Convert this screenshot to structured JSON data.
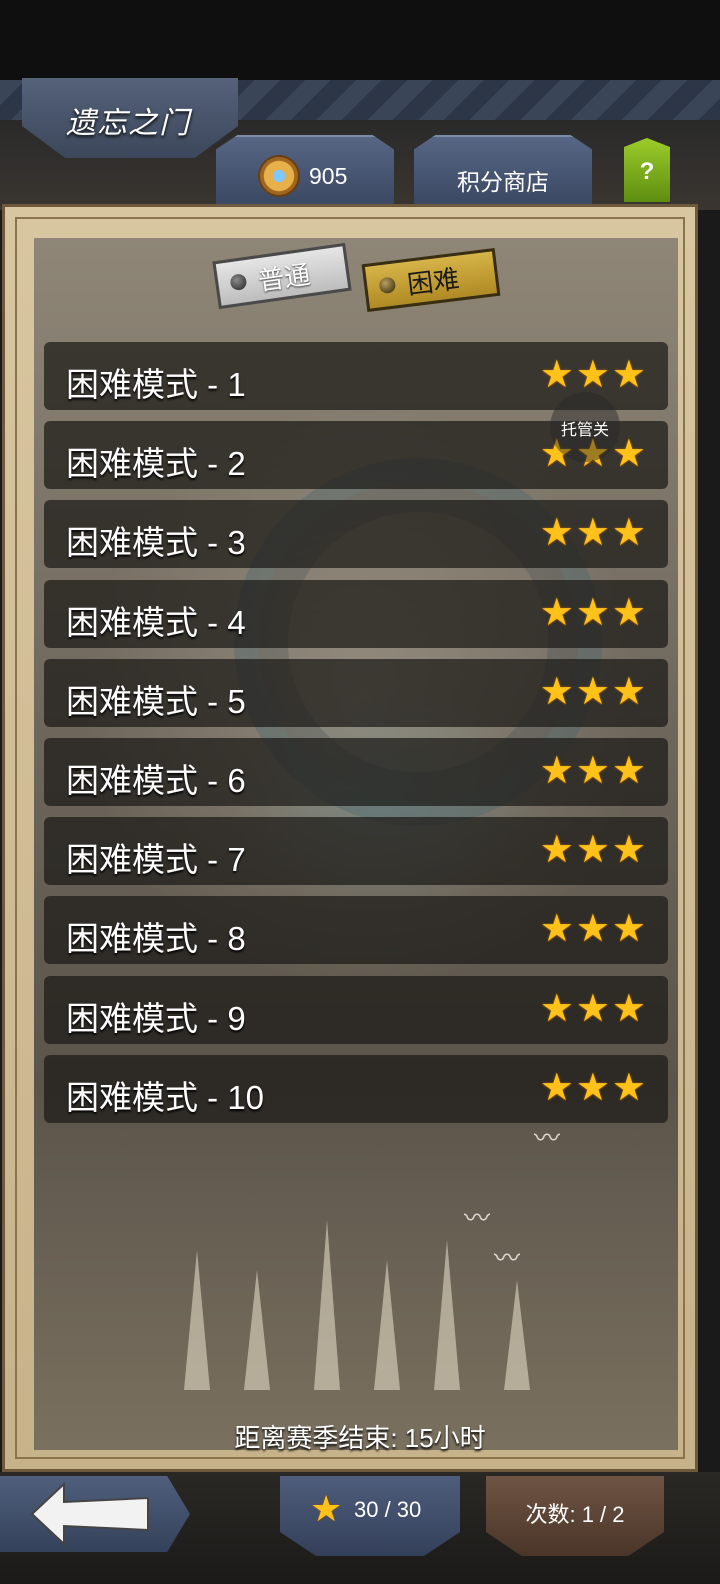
{
  "header": {
    "title": "遗忘之门",
    "coins": "905",
    "shop_label": "积分商店",
    "help_label": "?"
  },
  "mode_tabs": {
    "normal_label": "普通",
    "hard_label": "困难",
    "selected": "hard"
  },
  "levels": [
    {
      "label": "困难模式 - 1",
      "stars": 3
    },
    {
      "label": "困难模式 - 2",
      "stars": 3
    },
    {
      "label": "困难模式 - 3",
      "stars": 3
    },
    {
      "label": "困难模式 - 4",
      "stars": 3
    },
    {
      "label": "困难模式 - 5",
      "stars": 3
    },
    {
      "label": "困难模式 - 6",
      "stars": 3
    },
    {
      "label": "困难模式 - 7",
      "stars": 3
    },
    {
      "label": "困难模式 - 8",
      "stars": 3
    },
    {
      "label": "困难模式 - 9",
      "stars": 3
    },
    {
      "label": "困难模式 - 10",
      "stars": 3
    }
  ],
  "overlay_button": "托管关",
  "season_text": "距离赛季结束: 15小时",
  "footer": {
    "stars_total": "30 / 30",
    "attempts": "次数: 1 / 2"
  },
  "colors": {
    "star": "#ffc21a",
    "hard_tab": "#c9a23a",
    "row_bg": "#1c1a18"
  },
  "icons": {
    "coin": "medal-coin-icon",
    "back": "arrow-left-icon",
    "star": "star-icon"
  }
}
